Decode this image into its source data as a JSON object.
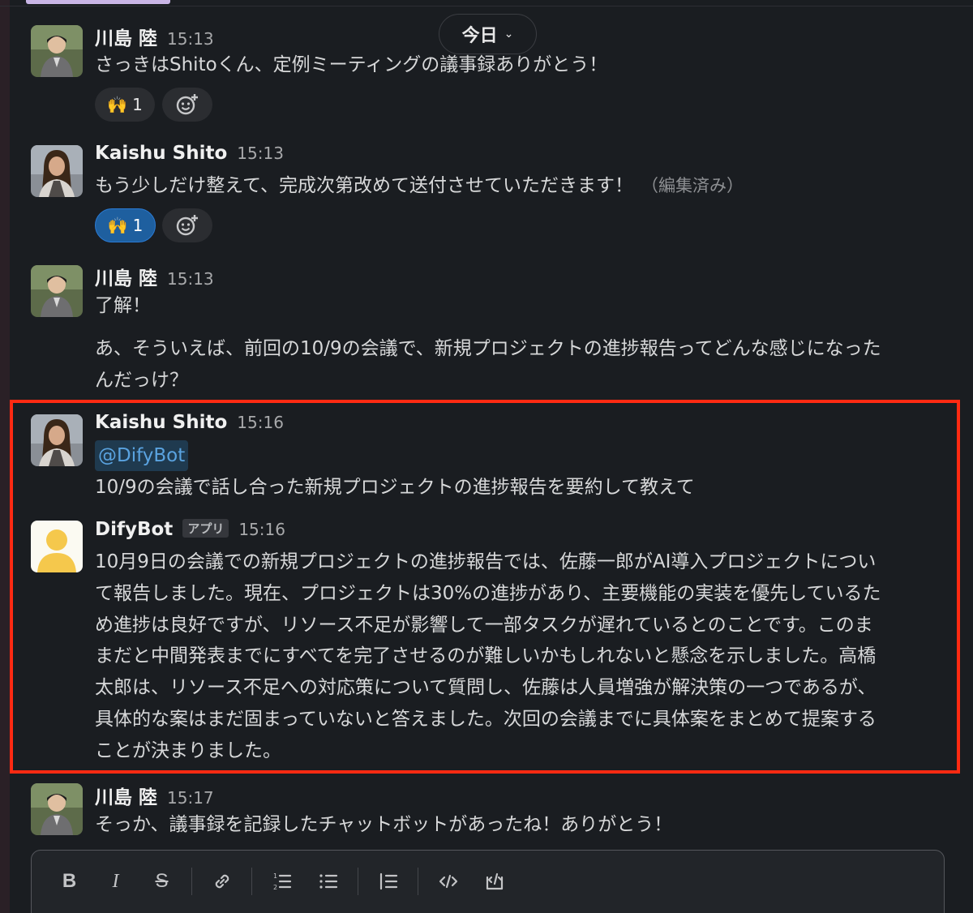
{
  "date_divider": {
    "label": "今日",
    "chevron": "chevron-down-icon"
  },
  "messages": [
    {
      "author": "川島 陸",
      "time": "15:13",
      "text": "さっきはShitoくん、定例ミーティングの議事録ありがとう！",
      "reaction": {
        "emoji": "🙌",
        "count": "1",
        "active": false
      }
    },
    {
      "author": "Kaishu Shito",
      "time": "15:13",
      "text": "もう少しだけ整えて、完成次第改めて送付させていただきます！",
      "edited": "（編集済み）",
      "reaction": {
        "emoji": "🙌",
        "count": "1",
        "active": true
      }
    },
    {
      "author": "川島 陸",
      "time": "15:13",
      "text": "了解！",
      "text2_line1": "あ、そういえば、前回の10/9の会議で、新規プロジェクトの進捗報告ってどんな感じになった",
      "text2_line2": "んだっけ？"
    },
    {
      "author": "Kaishu Shito",
      "time": "15:16",
      "mention": "@DifyBot",
      "text": "10/9の会議で話し合った新規プロジェクトの進捗報告を要約して教えて"
    },
    {
      "author": "DifyBot",
      "badge": "アプリ",
      "time": "15:16",
      "lines": [
        "10月9日の会議での新規プロジェクトの進捗報告では、佐藤一郎がAI導入プロジェクトについ",
        "て報告しました。現在、プロジェクトは30%の進捗があり、主要機能の実装を優先しているた",
        "め進捗は良好ですが、リソース不足が影響して一部タスクが遅れているとのことです。このま",
        "まだと中間発表までにすべてを完了させるのが難しいかもしれないと懸念を示しました。高橋",
        "太郎は、リソース不足への対応策について質問し、佐藤は人員増強が解決策の一つであるが、",
        "具体的な案はまだ固まっていないと答えました。次回の会議までに具体案をまとめて提案する",
        "ことが決まりました。"
      ]
    },
    {
      "author": "川島 陸",
      "time": "15:17",
      "text": "そっか、議事録を記録したチャットボットがあったね！ありがとう！"
    }
  ],
  "composer": {
    "toolbar": [
      "bold-icon",
      "italic-icon",
      "strikethrough-icon",
      "link-icon",
      "ordered-list-icon",
      "bulleted-list-icon",
      "blockquote-icon",
      "code-icon",
      "code-block-icon"
    ]
  },
  "colors": {
    "highlight": "#ff2a12",
    "mention": "#5aa3e0",
    "reaction_active": "#1e5f9f"
  }
}
